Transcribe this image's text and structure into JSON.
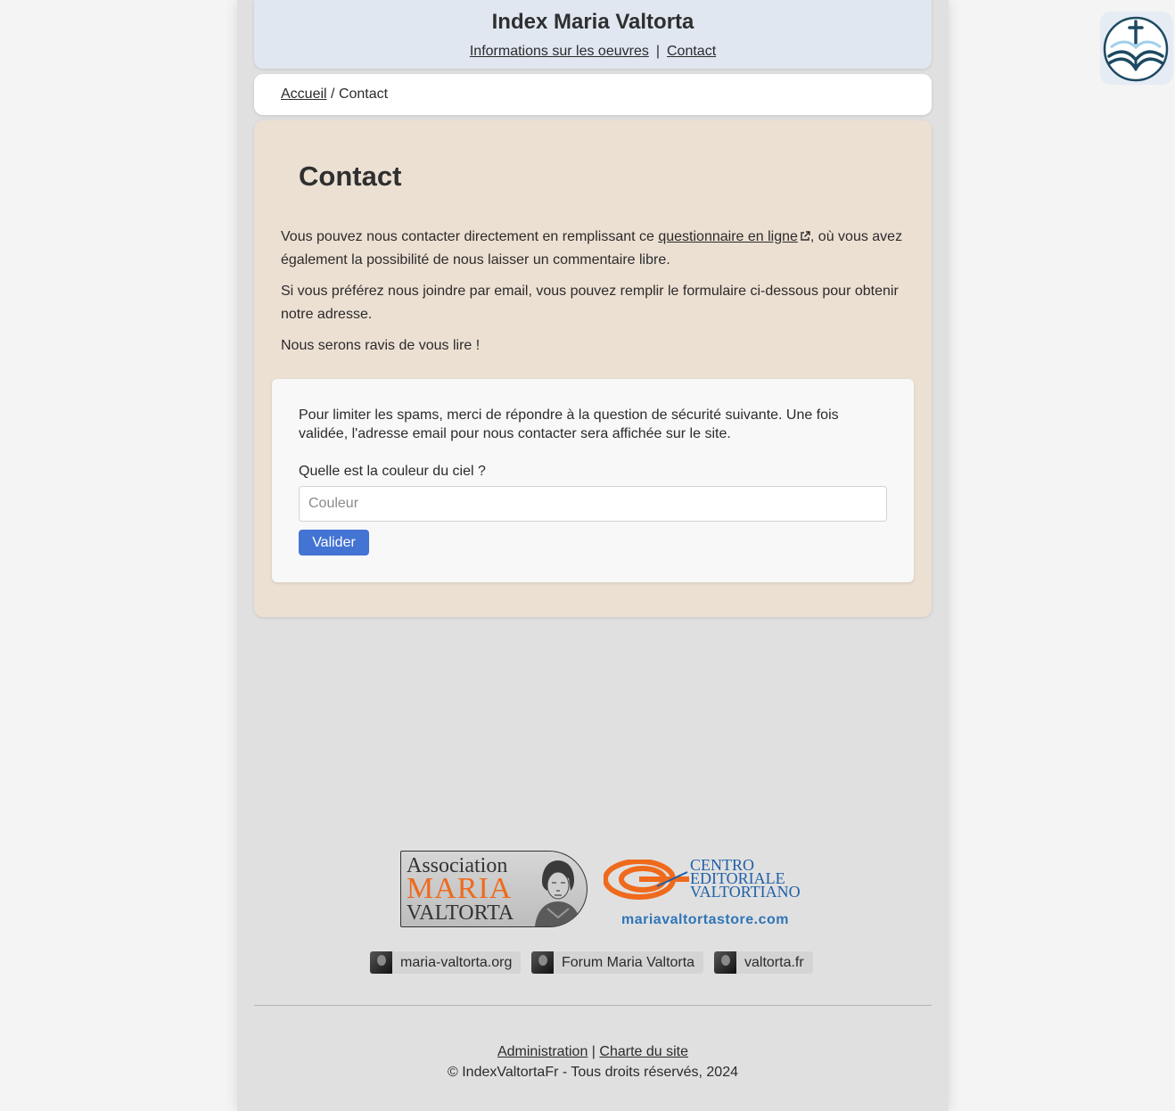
{
  "header": {
    "site_title": "Index Maria Valtorta",
    "nav": {
      "works_label": "Informations sur les oeuvres",
      "separator": "|",
      "contact_label": "Contact"
    }
  },
  "breadcrumb": {
    "home_label": "Accueil",
    "separator": "/",
    "current_label": "Contact"
  },
  "main": {
    "title": "Contact",
    "intro": {
      "p1_before": "Vous pouvez nous contacter directement en remplissant ce ",
      "p1_link": "questionnaire en ligne",
      "p1_after": ", où vous avez également la possibilité de nous laisser un commentaire libre.",
      "p2": "Si vous préférez nous joindre par email, vous pouvez remplir le formulaire ci-dessous pour obtenir notre adresse.",
      "p3": "Nous serons ravis de vous lire !"
    },
    "security_form": {
      "explanation": "Pour limiter les spams, merci de répondre à la question de sécurité suivante. Une fois validée, l'adresse email pour nous contacter sera affichée sur le site.",
      "question_label": "Quelle est la couleur du ciel ?",
      "answer_value": "",
      "answer_placeholder": "Couleur",
      "submit_label": "Valider"
    }
  },
  "partners": {
    "association": {
      "line1": "Association",
      "line2": "MARIA",
      "line3": "VALTORTA"
    },
    "cev": {
      "line1": "CENTRO",
      "line2": "EDITORIALE",
      "line3": "VALTORTIANO",
      "url": "mariavaltortastore.com"
    }
  },
  "links": [
    {
      "label": "maria-valtorta.org",
      "icon": "portrait-thumbnail-icon"
    },
    {
      "label": "Forum Maria Valtorta",
      "icon": "portrait-thumbnail-icon"
    },
    {
      "label": "valtorta.fr",
      "icon": "portrait-thumbnail-icon"
    }
  ],
  "footer": {
    "admin_label": "Administration",
    "separator": "|",
    "charter_label": "Charte du site",
    "copyright": "© IndexValtortaFr - Tous droits réservés, 2024"
  },
  "corner_logo": {
    "icon": "cross-book-icon"
  },
  "colors": {
    "accent_button": "#4373d3",
    "header_bg": "#e0e7f1",
    "main_bg": "#ece0d3",
    "assoc_orange": "#ef6a1c",
    "cev_blue": "#2f75b8",
    "logo_navy": "#1d4a63"
  }
}
